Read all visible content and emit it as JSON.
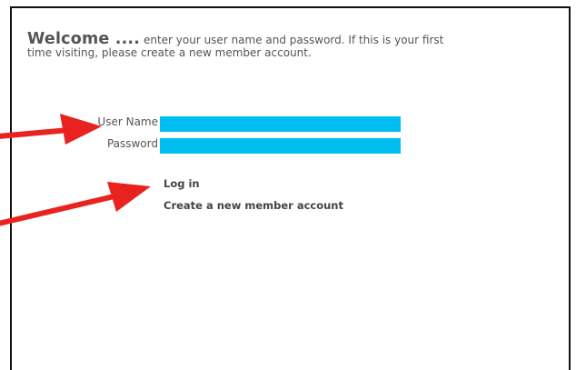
{
  "intro": {
    "welcome": "Welcome ....",
    "message": " enter your user name and password. If this is your first time visiting, please create a new member account."
  },
  "form": {
    "username_label": "User Name",
    "password_label": "Password",
    "username_value": "",
    "password_value": ""
  },
  "links": {
    "login": "Log in",
    "create_account": "Create a new member account"
  },
  "colors": {
    "field": "#00bff0",
    "arrow": "#e8231f",
    "text": "#555555"
  }
}
